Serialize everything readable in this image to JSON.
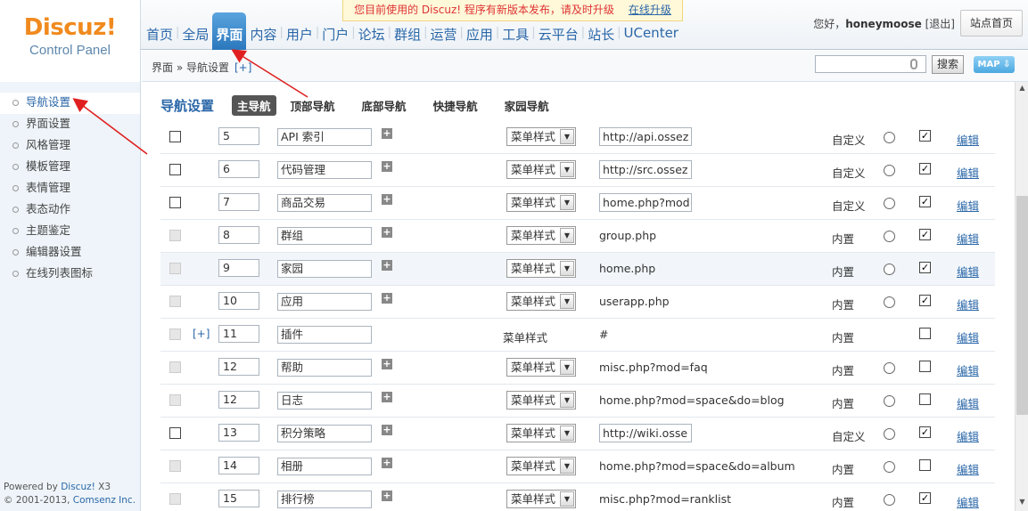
{
  "logo": {
    "title": "Discuz!",
    "subtitle": "Control Panel"
  },
  "notice": {
    "text": "您目前使用的 Discuz! 程序有新版本发布，请及时升级",
    "link": "在线升级"
  },
  "topnav": [
    "首页",
    "全局",
    "界面",
    "内容",
    "用户",
    "门户",
    "论坛",
    "群组",
    "运营",
    "应用",
    "工具",
    "云平台",
    "站长",
    "UCenter"
  ],
  "topnav_active": 2,
  "userbar": {
    "greeting": "您好，",
    "username": "honeymoose",
    "logout": "[退出]",
    "site_home": "站点首页"
  },
  "breadcrumb": {
    "text": "界面 » 导航设置",
    "plus": "[+]"
  },
  "search": {
    "button": "搜索",
    "map": "MAP ⇩"
  },
  "sidebar": [
    "导航设置",
    "界面设置",
    "风格管理",
    "模板管理",
    "表情管理",
    "表态动作",
    "主题鉴定",
    "编辑器设置",
    "在线列表图标"
  ],
  "sidebar_active": 0,
  "footer": {
    "line1_prefix": "Powered by ",
    "line1_brand": "Discuz!",
    "line1_suffix": " X3",
    "line2_prefix": "© 2001-2013, ",
    "line2_brand": "Comsenz Inc."
  },
  "page_heading": "导航设置",
  "tabs": [
    "主导航",
    "顶部导航",
    "底部导航",
    "快捷导航",
    "家园导航"
  ],
  "tabs_active": 0,
  "rows": [
    {
      "cb_enabled": true,
      "order": "5",
      "name": "API 索引",
      "plus": true,
      "style_select": true,
      "style": "菜单样式",
      "url": "http://api.ossez",
      "url_input": true,
      "type": "自定义",
      "radio": true,
      "checked": true,
      "edit": "编辑"
    },
    {
      "cb_enabled": true,
      "order": "6",
      "name": "代码管理",
      "plus": true,
      "style_select": true,
      "style": "菜单样式",
      "url": "http://src.ossez",
      "url_input": true,
      "type": "自定义",
      "radio": true,
      "checked": true,
      "edit": "编辑"
    },
    {
      "cb_enabled": true,
      "order": "7",
      "name": "商品交易",
      "plus": true,
      "style_select": true,
      "style": "菜单样式",
      "url": "home.php?mod=",
      "url_input": true,
      "type": "自定义",
      "radio": true,
      "checked": true,
      "edit": "编辑"
    },
    {
      "cb_enabled": false,
      "order": "8",
      "name": "群组",
      "plus": true,
      "style_select": true,
      "style": "菜单样式",
      "url": "group.php",
      "url_input": false,
      "type": "内置",
      "radio": true,
      "checked": true,
      "edit": "编辑"
    },
    {
      "cb_enabled": false,
      "order": "9",
      "name": "家园",
      "plus": true,
      "style_select": true,
      "style": "菜单样式",
      "url": "home.php",
      "url_input": false,
      "type": "内置",
      "radio": true,
      "checked": true,
      "edit": "编辑",
      "highlight": true
    },
    {
      "cb_enabled": false,
      "order": "10",
      "name": "应用",
      "plus": true,
      "style_select": true,
      "style": "菜单样式",
      "url": "userapp.php",
      "url_input": false,
      "type": "内置",
      "radio": true,
      "checked": true,
      "edit": "编辑"
    },
    {
      "cb_enabled": false,
      "sub_plus": "[+]",
      "order": "11",
      "name": "插件",
      "plus": false,
      "style_select": false,
      "style": "菜单样式",
      "url": "#",
      "url_input": false,
      "type": "内置",
      "radio": false,
      "checked": false,
      "edit": "编辑"
    },
    {
      "cb_enabled": false,
      "order": "12",
      "name": "帮助",
      "plus": true,
      "style_select": true,
      "style": "菜单样式",
      "url": "misc.php?mod=faq",
      "url_input": false,
      "type": "内置",
      "radio": true,
      "checked": false,
      "edit": "编辑"
    },
    {
      "cb_enabled": false,
      "order": "12",
      "name": "日志",
      "plus": true,
      "style_select": true,
      "style": "菜单样式",
      "url": "home.php?mod=space&do=blog",
      "url_input": false,
      "type": "内置",
      "radio": true,
      "checked": false,
      "edit": "编辑"
    },
    {
      "cb_enabled": true,
      "order": "13",
      "name": "积分策略",
      "plus": true,
      "style_select": true,
      "style": "菜单样式",
      "url": "http://wiki.osse",
      "url_input": true,
      "type": "自定义",
      "radio": true,
      "checked": true,
      "edit": "编辑"
    },
    {
      "cb_enabled": false,
      "order": "14",
      "name": "相册",
      "plus": true,
      "style_select": true,
      "style": "菜单样式",
      "url": "home.php?mod=space&do=album",
      "url_input": false,
      "type": "内置",
      "radio": true,
      "checked": false,
      "edit": "编辑"
    },
    {
      "cb_enabled": false,
      "order": "15",
      "name": "排行榜",
      "plus": true,
      "style_select": true,
      "style": "菜单样式",
      "url": "misc.php?mod=ranklist",
      "url_input": false,
      "type": "内置",
      "radio": true,
      "checked": true,
      "edit": "编辑"
    }
  ],
  "colors": {
    "accent": "#2a67a8",
    "logo": "#f08a1e",
    "arrow": "#e02020"
  }
}
